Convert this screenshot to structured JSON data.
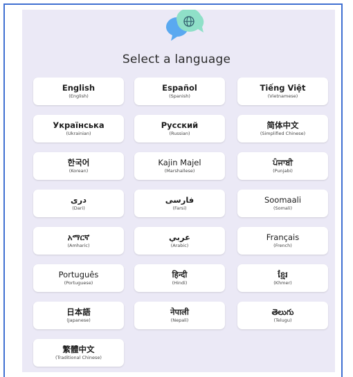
{
  "title": "Select a language",
  "colors": {
    "panel": "#ebe9f6",
    "bubble_blue": "#5aa9f0",
    "bubble_green": "#8fe0c8",
    "frame": "#3f6fd1"
  },
  "icons": {
    "logo": "chat-bubbles-globe-icon"
  },
  "languages": [
    {
      "native": "English",
      "english": "(English)"
    },
    {
      "native": "Español",
      "english": "(Spanish)"
    },
    {
      "native": "Tiếng Việt",
      "english": "(Vietnamese)"
    },
    {
      "native": "Українська",
      "english": "(Ukrainian)"
    },
    {
      "native": "Русский",
      "english": "(Russian)"
    },
    {
      "native": "简体中文",
      "english": "(Simplified Chinese)"
    },
    {
      "native": "한국어",
      "english": "(Korean)"
    },
    {
      "native": "Kajin Majel",
      "english": "(Marshallese)"
    },
    {
      "native": "ਪੰਜਾਬੀ",
      "english": "(Punjabi)"
    },
    {
      "native": "دری",
      "english": "(Dari)"
    },
    {
      "native": "فارسی",
      "english": "(Farsi)"
    },
    {
      "native": "Soomaali",
      "english": "(Somali)"
    },
    {
      "native": "አማርኛ",
      "english": "(Amharic)"
    },
    {
      "native": "عربي",
      "english": "(Arabic)"
    },
    {
      "native": "Français",
      "english": "(French)"
    },
    {
      "native": "Português",
      "english": "(Portuguese)"
    },
    {
      "native": "हिन्दी",
      "english": "(Hindi)"
    },
    {
      "native": "ខ្មែរ",
      "english": "(Khmer)"
    },
    {
      "native": "日本語",
      "english": "(Japanese)"
    },
    {
      "native": "नेपाली",
      "english": "(Nepali)"
    },
    {
      "native": "తెలుగు",
      "english": "(Telugu)"
    },
    {
      "native": "繁體中文",
      "english": "(Traditional Chinese)"
    }
  ]
}
